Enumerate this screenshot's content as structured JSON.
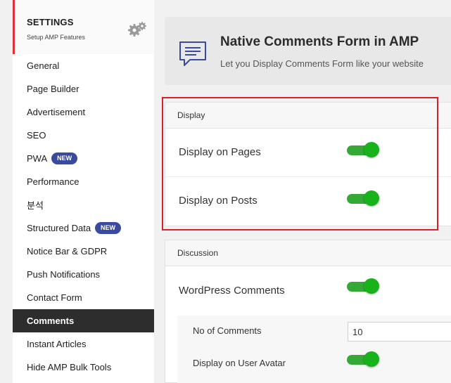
{
  "sidebar": {
    "title": "SETTINGS",
    "subtitle": "Setup AMP Features",
    "items": [
      {
        "label": "General"
      },
      {
        "label": "Page Builder"
      },
      {
        "label": "Advertisement"
      },
      {
        "label": "SEO"
      },
      {
        "label": "PWA",
        "badge": "NEW"
      },
      {
        "label": "Performance"
      },
      {
        "label": "분석"
      },
      {
        "label": "Structured Data",
        "badge": "NEW"
      },
      {
        "label": "Notice Bar & GDPR"
      },
      {
        "label": "Push Notifications"
      },
      {
        "label": "Contact Form"
      },
      {
        "label": "Comments",
        "active": true
      },
      {
        "label": "Instant Articles"
      },
      {
        "label": "Hide AMP Bulk Tools"
      }
    ]
  },
  "header": {
    "title": "Native Comments Form in AMP",
    "description": "Let you Display Comments Form like your website"
  },
  "display": {
    "title": "Display",
    "pages_label": "Display on Pages",
    "pages_enabled": true,
    "posts_label": "Display on Posts",
    "posts_enabled": true
  },
  "discussion": {
    "title": "Discussion",
    "wp_comments_label": "WordPress Comments",
    "wp_comments_enabled": true,
    "count_label": "No of Comments",
    "count_value": "10",
    "avatar_label": "Display on User Avatar",
    "avatar_enabled": true
  },
  "colors": {
    "toggle_on": "#18b21b",
    "highlight": "#d7202a",
    "badge": "#3a4aa0",
    "active_nav": "#2d2d2d"
  }
}
